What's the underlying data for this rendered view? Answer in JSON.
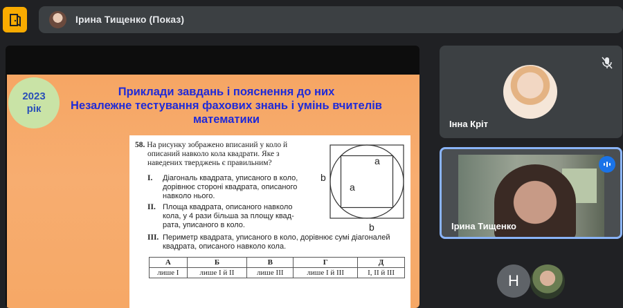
{
  "meeting": {
    "presenter_label": "Ірина Тищенко (Показ)"
  },
  "slide": {
    "year_line1": "2023",
    "year_line2": "рік",
    "title_line1": "Приклади завдань і пояснення до них",
    "title_line2": "Незалежне тестування фахових знань і умінь вчителів",
    "title_line3": "математики",
    "problem_number": "58.",
    "problem_text_1": "На рисунку зображено вписаний у коло й",
    "problem_text_2": "описаний навколо кола квадрати. Яке з",
    "problem_text_3": "наведених тверджень є правильним?",
    "statements": [
      {
        "roman": "I.",
        "line1": "Діагональ квадрата, уписаного в коло,",
        "line2": "дорівнює стороні квадрата, описаного",
        "line3": "навколо нього."
      },
      {
        "roman": "II.",
        "line1": "Площа квадрата, описаного навколо",
        "line2": "кола, у 4 рази більша за площу квад-",
        "line3": "рата, уписаного в коло."
      },
      {
        "roman": "III.",
        "line1": "Периметр квадрата, уписаного в коло, дорівнює сумі діагоналей",
        "line2": "квадрата, описаного навколо кола."
      }
    ],
    "figure_labels": {
      "a_top": "a",
      "a_left": "a",
      "b_left": "b",
      "b_bottom": "b"
    },
    "answer_headers": [
      "А",
      "Б",
      "В",
      "Г",
      "Д"
    ],
    "answer_options": [
      "лише I",
      "лише I й II",
      "лише III",
      "лише I й III",
      "I, II й III"
    ]
  },
  "participants": [
    {
      "name": "Інна Кріт",
      "mic": "muted"
    },
    {
      "name": "Ірина Тищенко",
      "status": "speaking"
    }
  ],
  "others": {
    "initial": "Н"
  },
  "colors": {
    "accent": "#f9ab00",
    "active_border": "#8ab4f8",
    "speaking": "#1a73e8",
    "slide_title": "#1f2ad8"
  }
}
